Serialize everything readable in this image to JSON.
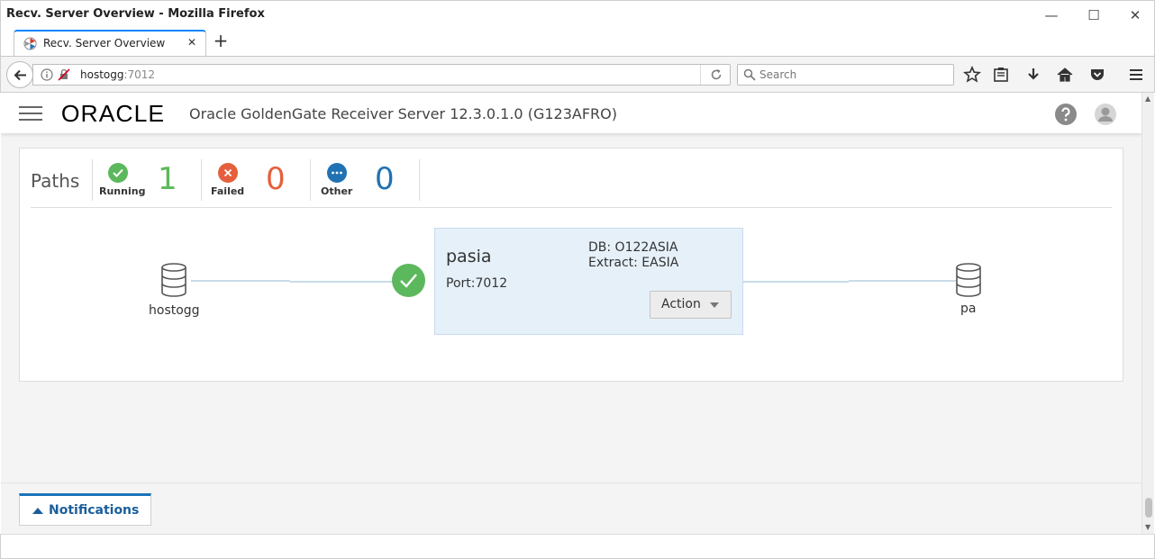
{
  "window": {
    "title": "Recv. Server Overview - Mozilla Firefox",
    "minimize": "—",
    "maximize": "☐",
    "close": "✕"
  },
  "tab": {
    "label": "Recv. Server Overview",
    "close": "✕",
    "new_tab": "+"
  },
  "navbar": {
    "url_host": "hostogg",
    "url_port": ":7012",
    "search_placeholder": "Search"
  },
  "header": {
    "logo": "ORACLE",
    "title": "Oracle GoldenGate Receiver Server 12.3.0.1.0 (G123AFRO)"
  },
  "paths": {
    "label": "Paths",
    "running": {
      "label": "Running",
      "count": "1",
      "color": "#5cb85c"
    },
    "failed": {
      "label": "Failed",
      "count": "0",
      "color": "#e55f3c"
    },
    "other": {
      "label": "Other",
      "count": "0",
      "color": "#2072b3"
    }
  },
  "diagram": {
    "source_node": "hostogg",
    "target_node": "pa",
    "path": {
      "name": "pasia",
      "port": "Port:7012",
      "db": "DB: O122ASIA",
      "extract": "Extract: EASIA",
      "action_label": "Action"
    }
  },
  "notifications": {
    "label": "Notifications"
  }
}
